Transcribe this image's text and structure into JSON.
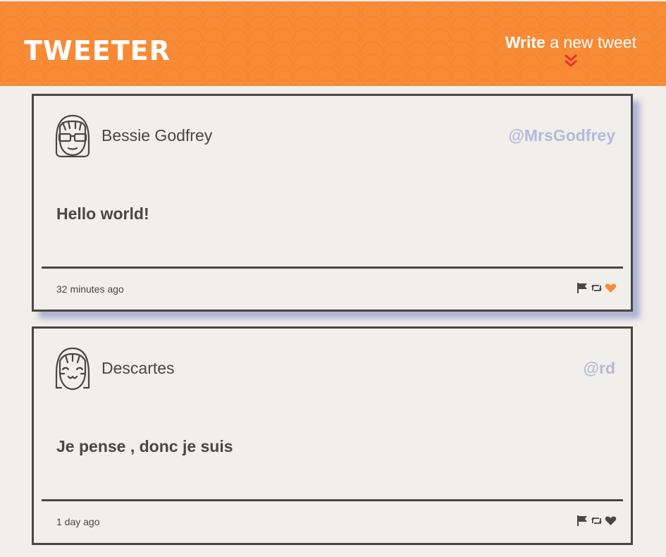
{
  "header": {
    "logo_text": "TWEETER",
    "compose_bold": "Write",
    "compose_rest": " a new tweet",
    "accent_color": "#f88b36",
    "arrow_color": "#e8302a"
  },
  "tweets": [
    {
      "name": "Bessie Godfrey",
      "handle": "@MrsGodfrey",
      "content": "Hello world!",
      "time": "32 minutes ago",
      "liked": true,
      "avatar": "sunglasses-avatar-icon"
    },
    {
      "name": "Descartes",
      "handle": "@rd",
      "content": "Je pense , donc je suis",
      "time": "1 day ago",
      "liked": false,
      "avatar": "smiling-avatar-icon"
    }
  ]
}
